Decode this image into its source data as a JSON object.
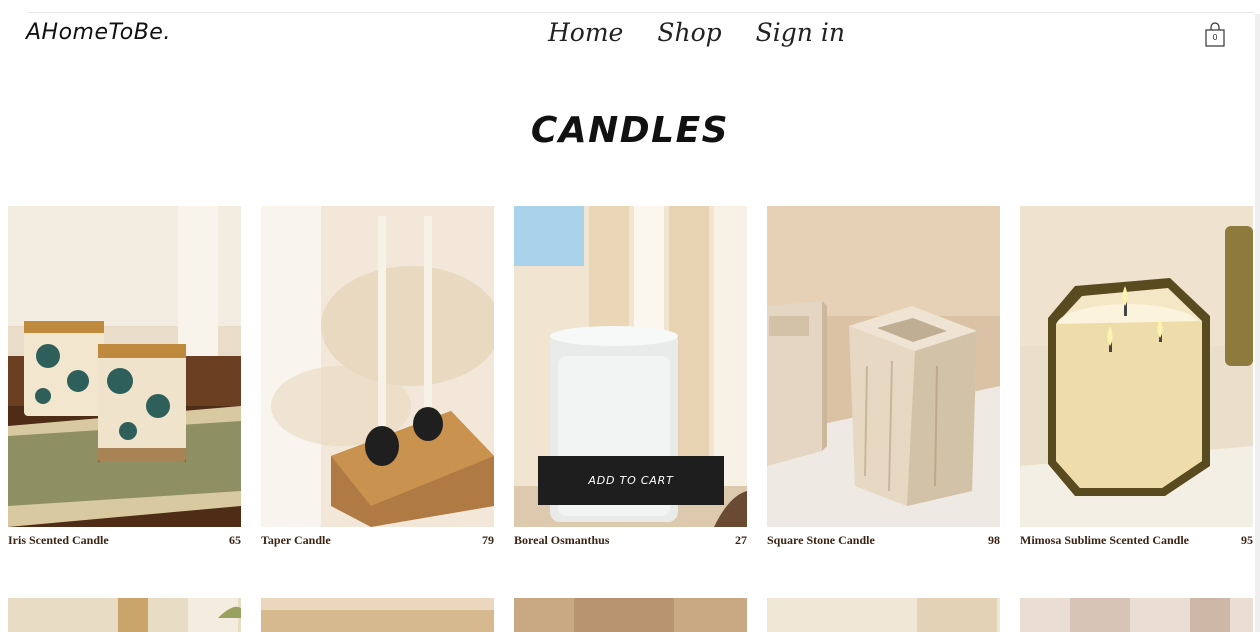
{
  "header": {
    "logo": "AHomeToBe.",
    "nav": [
      "Home",
      "Shop",
      "Sign in"
    ],
    "cart_count": "0"
  },
  "page_title": "CANDLES",
  "products": [
    {
      "name": "Iris Scented Candle",
      "price": "65"
    },
    {
      "name": "Taper Candle",
      "price": "79"
    },
    {
      "name": "Boreal Osmanthus",
      "price": "27"
    },
    {
      "name": "Square Stone Candle",
      "price": "98"
    },
    {
      "name": "Mimosa Sublime Scented Candle",
      "price": "95"
    }
  ],
  "hover_action": {
    "label": "ADD TO CART"
  },
  "icons": {
    "cart": "shopping-bag-icon"
  }
}
